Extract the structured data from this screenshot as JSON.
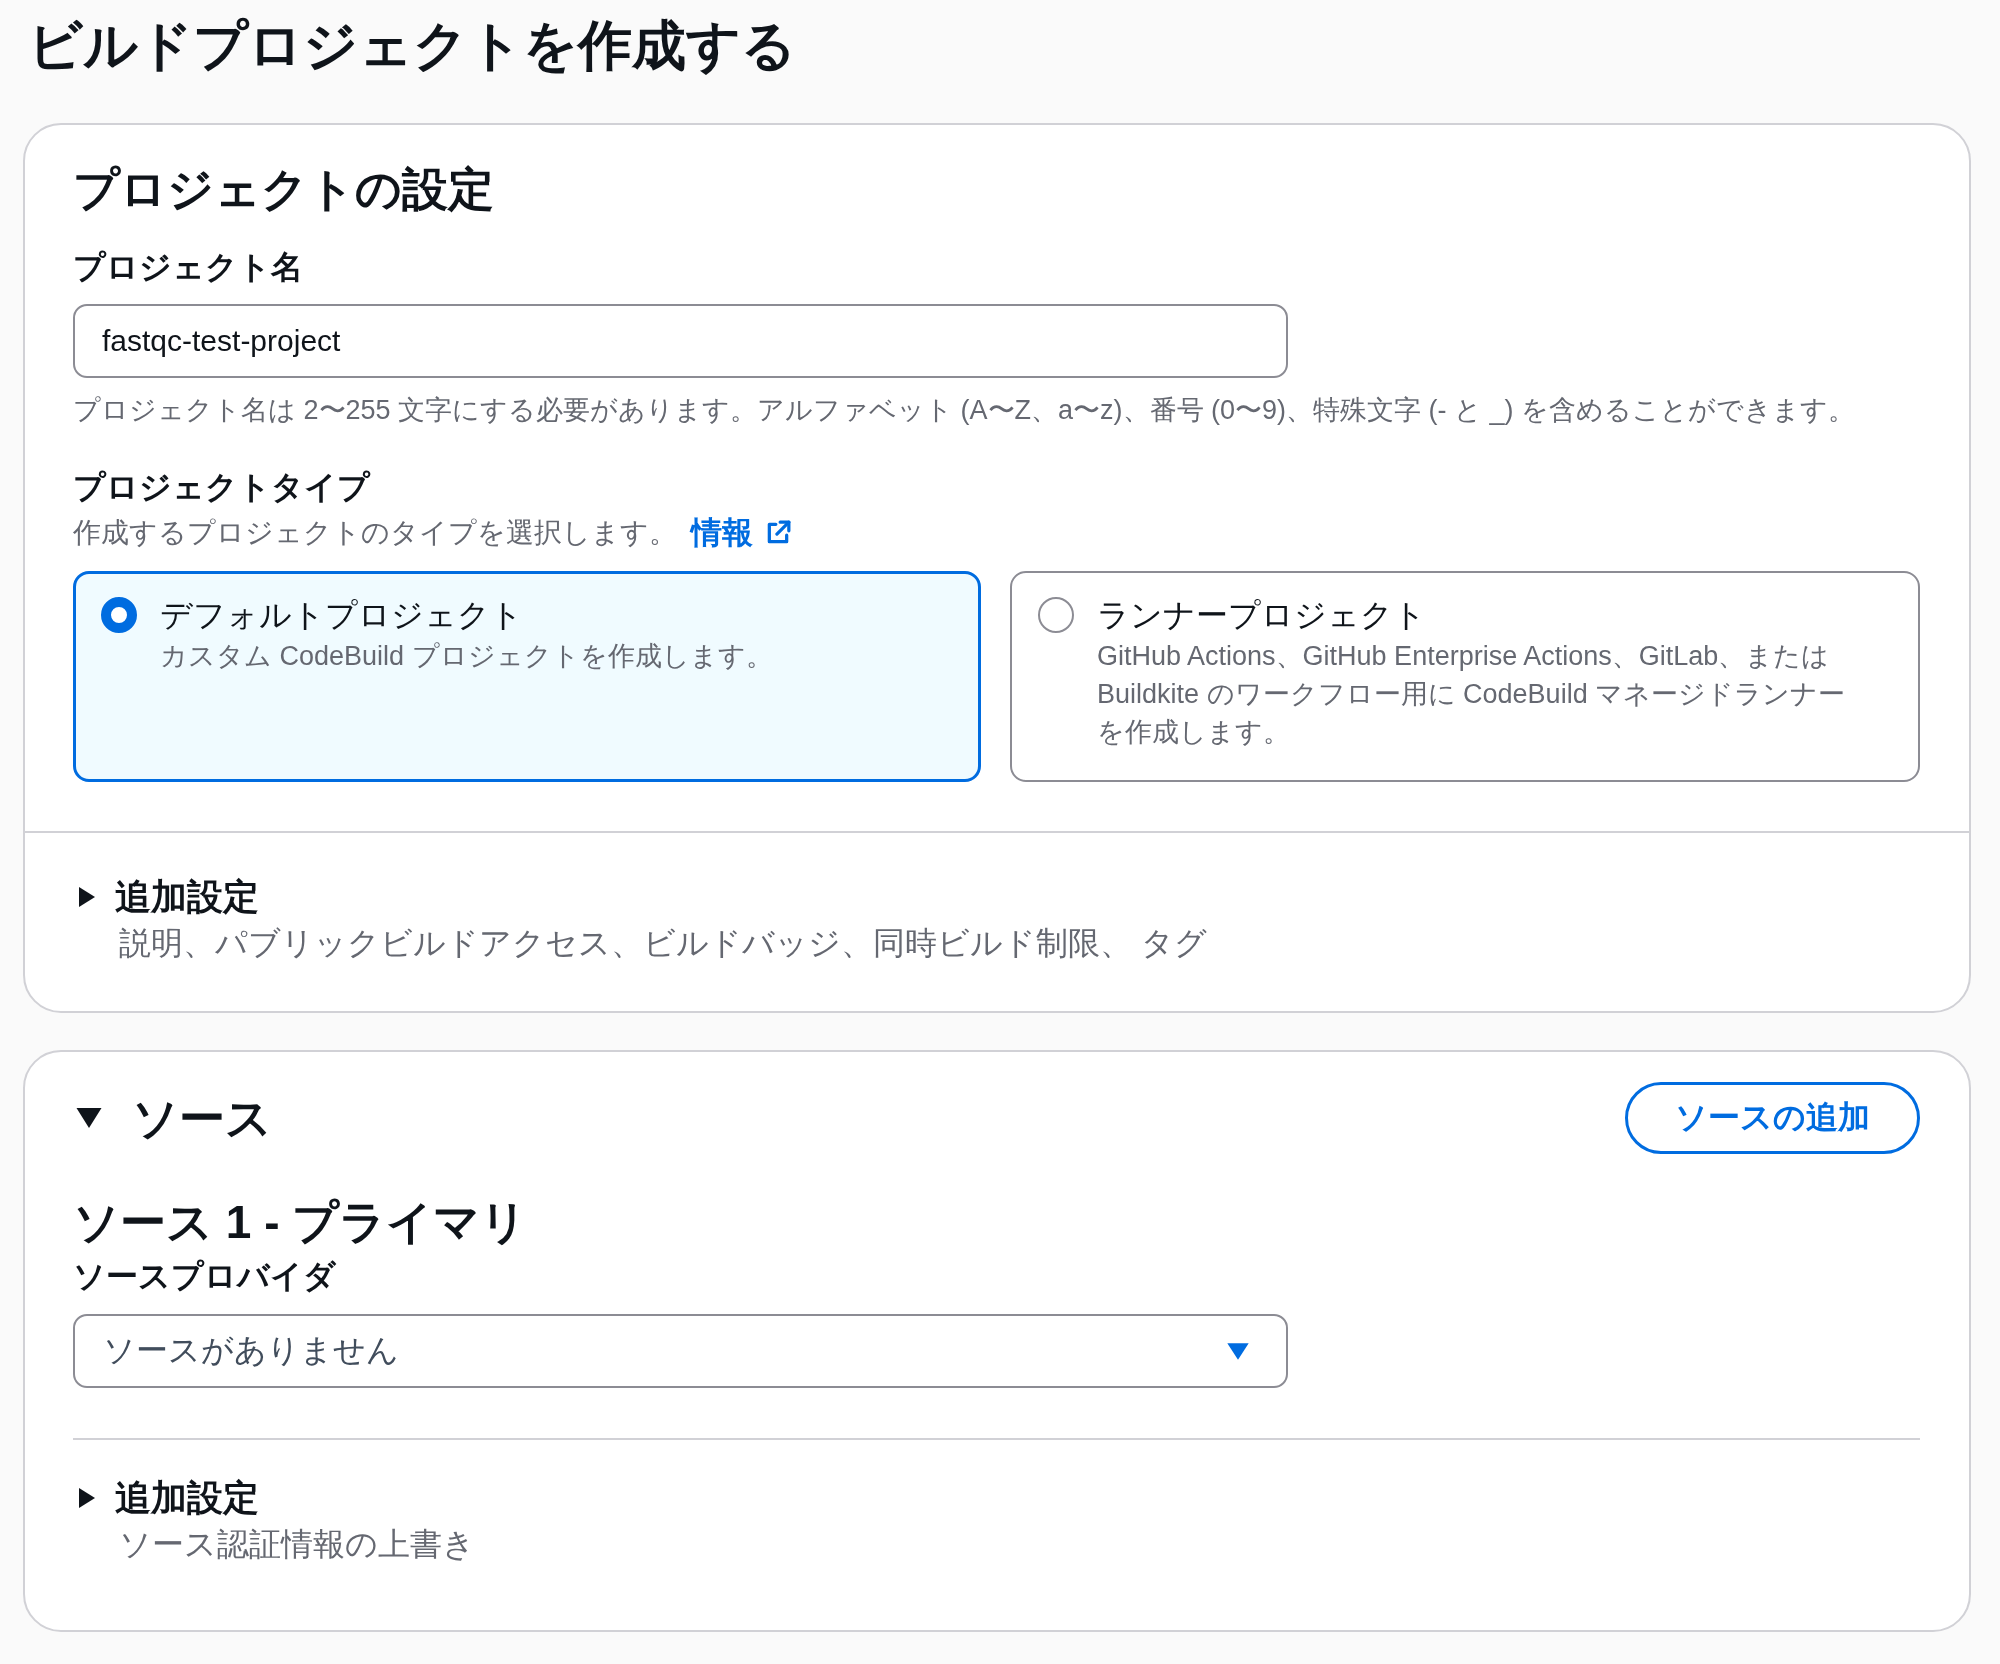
{
  "page_title": "ビルドプロジェクトを作成する",
  "project_settings": {
    "title": "プロジェクトの設定",
    "project_name": {
      "label": "プロジェクト名",
      "value": "fastqc-test-project",
      "hint": "プロジェクト名は 2〜255 文字にする必要があります。アルファベット (A〜Z、a〜z)、番号 (0〜9)、特殊文字 (- と _) を含めることができます。"
    },
    "project_type": {
      "label": "プロジェクトタイプ",
      "description": "作成するプロジェクトのタイプを選択します。",
      "info_link": "情報",
      "options": [
        {
          "title": "デフォルトプロジェクト",
          "description": "カスタム CodeBuild プロジェクトを作成します。",
          "selected": true
        },
        {
          "title": "ランナープロジェクト",
          "description": "GitHub Actions、GitHub Enterprise Actions、GitLab、または Buildkite のワークフロー用に CodeBuild マネージドランナーを作成します。",
          "selected": false
        }
      ]
    },
    "additional_settings": {
      "title": "追加設定",
      "summary": "説明、パブリックビルドアクセス、ビルドバッジ、同時ビルド制限、 タグ",
      "expanded": false
    }
  },
  "source": {
    "title": "ソース",
    "expanded": true,
    "add_button": "ソースの追加",
    "sources": [
      {
        "heading": "ソース 1 - プライマリ",
        "provider": {
          "label": "ソースプロバイダ",
          "value": "ソースがありません"
        },
        "additional_settings": {
          "title": "追加設定",
          "summary": "ソース認証情報の上書き",
          "expanded": false
        }
      }
    ]
  }
}
